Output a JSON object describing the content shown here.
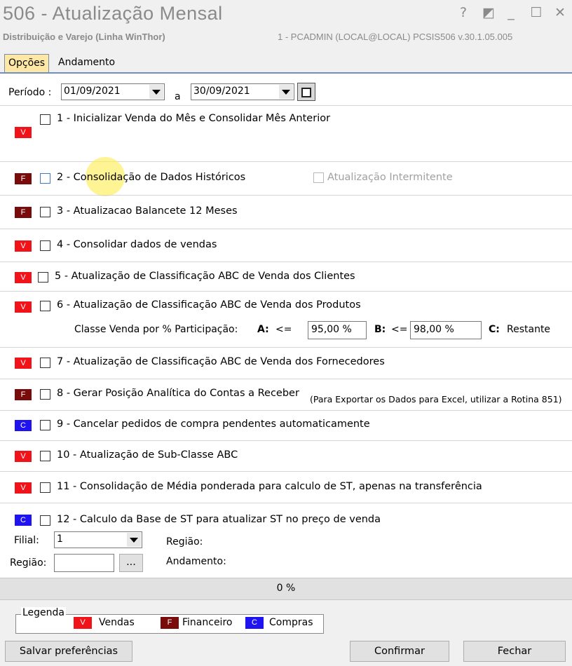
{
  "window": {
    "title": "506 - Atualização Mensal",
    "subtitle": "Distribuição e Varejo (Linha WinThor)",
    "user_info": "1 - PCADMIN (LOCAL@LOCAL)   PCSIS506  v.30.1.05.005",
    "buttons": [
      "?",
      "◩",
      "_",
      "☐",
      "✕"
    ]
  },
  "tabs": [
    "Opções",
    "Andamento"
  ],
  "periodo": {
    "label": "Período :",
    "start": "01/09/2021",
    "separator": "a",
    "end": "30/09/2021"
  },
  "items": [
    {
      "badge": "V",
      "label": "1 - Inicializar Venda do Mês e Consolidar Mês Anterior"
    },
    {
      "badge": "F",
      "label": "2 - Consolidação de Dados Históricos",
      "extra_checkbox": "Atualização Intermitente"
    },
    {
      "badge": "F",
      "label": "3 - Atualizacao Balancete 12 Meses"
    },
    {
      "badge": "V",
      "label": "4 - Consolidar dados de vendas"
    },
    {
      "badge": "V",
      "label": "5 - Atualização de Classificação ABC de Venda dos Clientes"
    },
    {
      "badge": "V",
      "label": "6 - Atualização de Classificação ABC de Venda dos Produtos"
    },
    {
      "badge": "V",
      "label": "7 - Atualização de Classificação ABC de Venda dos Fornecedores"
    },
    {
      "badge": "F",
      "label": "8 - Gerar  Posição Analítica do Contas a Receber",
      "note": "(Para Exportar os Dados para Excel, utilizar a Rotina 851)"
    },
    {
      "badge": "C",
      "label": "9 - Cancelar pedidos de compra pendentes automaticamente"
    },
    {
      "badge": "V",
      "label": "10 - Atualização de Sub-Classe ABC"
    },
    {
      "badge": "V",
      "label": "11 - Consolidação de Média ponderada para calculo de ST, apenas na transferência"
    },
    {
      "badge": "C",
      "label": "12 - Calculo da Base de ST para atualizar ST no preço de venda"
    }
  ],
  "classe": {
    "label": "Classe Venda por % Participação:",
    "a_label": "A:",
    "a_op": "<=",
    "a_value": "95,00 %",
    "b_label": "B:",
    "b_op": "<=",
    "b_value": "98,00 %",
    "c_label": "C:",
    "c_value": "Restante"
  },
  "item12": {
    "filial_label": "Filial:",
    "filial_value": "1",
    "regiao_label": "Região:",
    "regiao_value": "",
    "ellipsis": "...",
    "regiao_info_label": "Região:",
    "andamento_label": "Andamento:"
  },
  "progress": {
    "value": 0,
    "label": "0 %"
  },
  "legend": {
    "title": "Legenda",
    "entries": [
      {
        "badge": "V",
        "label": "Vendas"
      },
      {
        "badge": "F",
        "label": "Financeiro"
      },
      {
        "badge": "C",
        "label": "Compras"
      }
    ]
  },
  "buttons": {
    "save": "Salvar preferências",
    "confirm": "Confirmar",
    "close": "Fechar"
  },
  "colors": {
    "vendas": "#f0141a",
    "financeiro": "#7a0b0b",
    "compras": "#1f14f0",
    "active_tab": "#ffe8a6"
  }
}
